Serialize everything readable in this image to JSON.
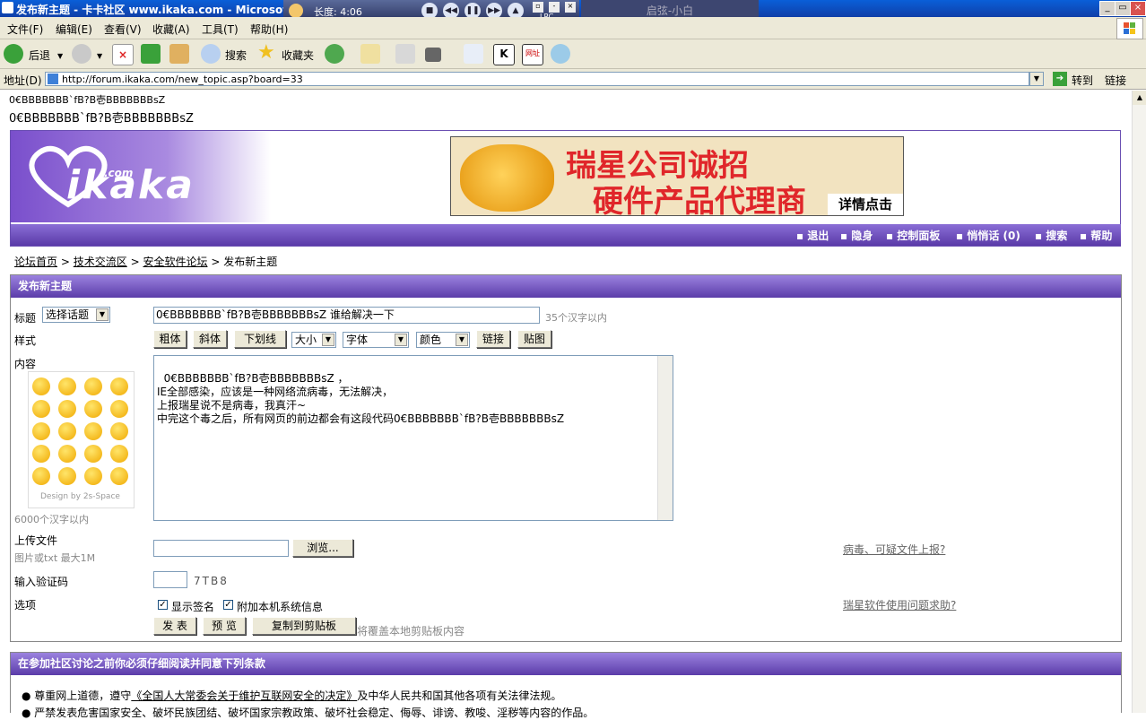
{
  "window": {
    "title": "发布新主题 - 卡卡社区 www.ikaka.com - Microsoft Internet Explorer",
    "buttons": [
      "_",
      "▭",
      "×"
    ]
  },
  "player": {
    "length": "长度: 4:06",
    "lrc": "LRC",
    "lyric": "启弦-小白"
  },
  "menu": [
    "文件(F)",
    "编辑(E)",
    "查看(V)",
    "收藏(A)",
    "工具(T)",
    "帮助(H)"
  ],
  "toolbar": {
    "back": "后退",
    "search": "搜索",
    "favorites": "收藏夹"
  },
  "address": {
    "label": "地址(D)",
    "url": "http://forum.ikaka.com/new_topic.asp?board=33",
    "go": "转到",
    "links": "链接"
  },
  "injected": {
    "line1": "0€BBBBBBB`fB?B壱BBBBBBBsZ",
    "line2": "0€BBBBBBB`fB?B壱BBBBBBBsZ"
  },
  "header": {
    "logo_text": "ikaka",
    "logo_sup": ".com",
    "banner_line1": "瑞星公司诚招",
    "banner_line2": "硬件产品代理商",
    "banner_detail": "详情点击",
    "nav": [
      "退出",
      "隐身",
      "控制面板",
      "悄悄话 (0)",
      "搜索",
      "帮助"
    ]
  },
  "breadcrumb": {
    "items": [
      "论坛首页",
      "技术交流区",
      "安全软件论坛"
    ],
    "current": "发布新主题",
    "sep": ">"
  },
  "form": {
    "section_title": "发布新主题",
    "title_label": "标题",
    "topic_select": "选择话题",
    "title_value": "0€BBBBBBB`fB?B壱BBBBBBBsZ 谁给解决一下",
    "title_hint": "35个汉字以内",
    "style_label": "样式",
    "style_buttons": [
      "粗体",
      "斜体",
      "下划线"
    ],
    "size_select": "大小",
    "font_select": "字体",
    "color_select": "颜色",
    "link_btn": "链接",
    "image_btn": "贴图",
    "content_label": "内容",
    "content_value": "0€BBBBBBB`fB?B壱BBBBBBBsZ ，\nIE全部感染，应该是一种网络流病毒，无法解决，\n上报瑞星说不是病毒，我真汗~\n中完这个毒之后，所有网页的前边都会有这段代码0€BBBBBBB`fB?B壱BBBBBBBsZ",
    "smilies_credit": "Design by 2s-Space",
    "content_hint": "6000个汉字以内",
    "upload_label": "上传文件",
    "upload_hint": "图片或txt 最大1M",
    "browse_btn": "浏览...",
    "report_link": "病毒、可疑文件上报?",
    "captcha_label": "输入验证码",
    "captcha_code": "7TB8",
    "options_label": "选项",
    "opt_signature": "显示签名",
    "opt_sysinfo": "附加本机系统信息",
    "help_link": "瑞星软件使用问题求助?",
    "submit_btn": "发 表",
    "preview_btn": "预 览",
    "copy_btn": "复制到剪贴板",
    "copy_hint": "将覆盖本地剪贴板内容"
  },
  "terms": {
    "title": "在参加社区讨论之前你必须仔细阅读并同意下列条款",
    "item1_pre": "尊重网上道德，遵守",
    "item1_link": "《全国人大常委会关于维护互联网安全的决定》",
    "item1_post": "及中华人民共和国其他各项有关法律法规。",
    "item2": "严禁发表危害国家安全、破坏民族团结、破坏国家宗教政策、破坏社会稳定、侮辱、诽谤、教唆、淫秽等内容的作品。"
  }
}
